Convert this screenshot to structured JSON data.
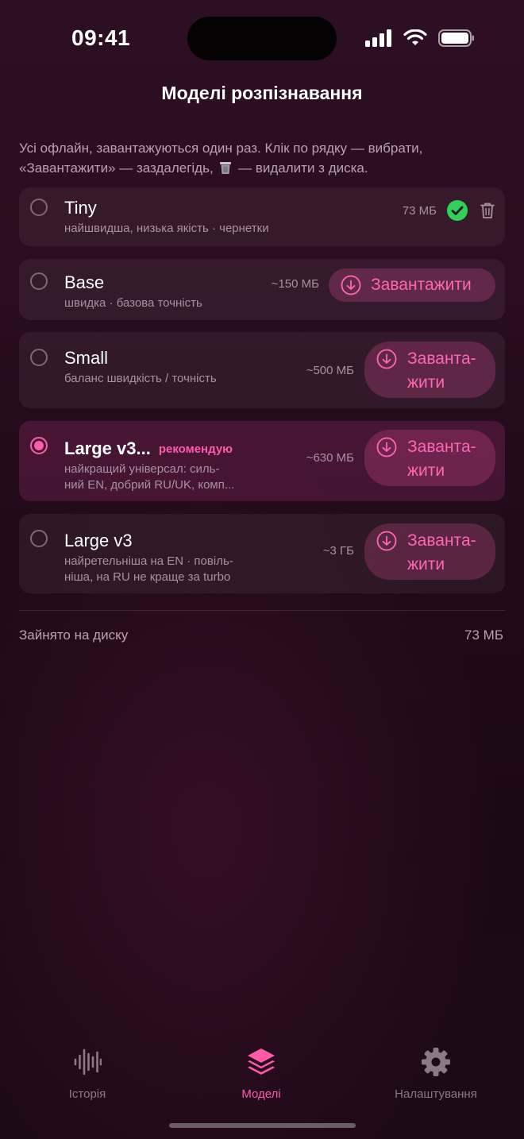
{
  "status": {
    "time": "09:41"
  },
  "nav": {
    "title": "Моделі розпізнавання"
  },
  "hint": {
    "part1": "Усі офлайн, завантажуються один раз. Клік по рядку — вибрати, «Завантажити» — заздалегідь,",
    "part2": "— видалити з диска."
  },
  "models": [
    {
      "name": "Tiny",
      "desc": "найшвидша, низька якість · чернетки",
      "size": "73 МБ",
      "status": "downloaded",
      "selected": false
    },
    {
      "name": "Base",
      "desc": "швидка · базова точність",
      "size": "~150 МБ",
      "button": "Завантажити",
      "selected": false
    },
    {
      "name": "Small",
      "desc": "баланс швидкість / точність",
      "size": "~500 МБ",
      "button_line1": "Заванта-",
      "button_line2": "жити",
      "selected": false
    },
    {
      "name": "Large v3...",
      "badge": "рекомендую",
      "desc_line1": "найкращий універсал: силь-",
      "desc_line2": "ний EN, добрий RU/UK, комп...",
      "size": "~630 МБ",
      "button_line1": "Заванта-",
      "button_line2": "жити",
      "selected": true
    },
    {
      "name": "Large v3",
      "desc_line1": "найретельніша на EN · повіль-",
      "desc_line2": "ніша, на RU не краще за turbo",
      "size": "~3 ГБ",
      "button_line1": "Заванта-",
      "button_line2": "жити",
      "selected": false
    }
  ],
  "disk": {
    "label": "Зайнято на диску",
    "value": "73 МБ"
  },
  "tabs": [
    {
      "label": "Історія",
      "icon": "waveform-icon",
      "active": false
    },
    {
      "label": "Моделі",
      "icon": "layers-icon",
      "active": true
    },
    {
      "label": "Налаштування",
      "icon": "gear-icon",
      "active": false
    }
  ],
  "colors": {
    "accent": "#ff5aac",
    "success": "#30d158",
    "background": "#2a0d20"
  }
}
